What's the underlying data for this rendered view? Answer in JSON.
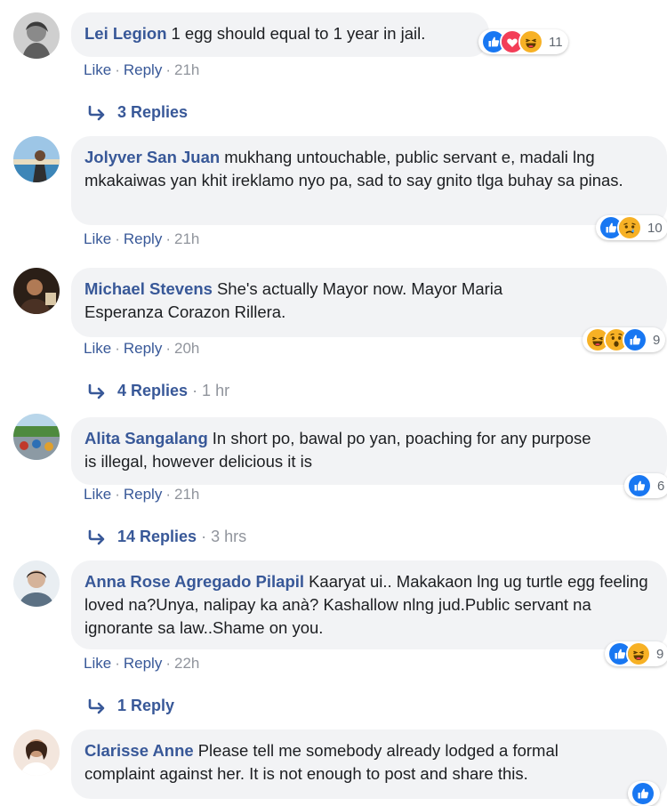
{
  "action_labels": {
    "like": "Like",
    "reply": "Reply",
    "sep": "·"
  },
  "comments": [
    {
      "author": "Lei Legion",
      "text": "1 egg should equal to 1 year in jail.",
      "time": "21h",
      "reactions": [
        "like",
        "love",
        "haha"
      ],
      "reaction_count": "11",
      "replies_label": "3 Replies",
      "replies_time": ""
    },
    {
      "author": "Jolyver San Juan",
      "text": "mukhang untouchable, public servant e, madali lng mkakaiwas yan khit ireklamo nyo pa, sad to say gnito tlga buhay sa pinas.",
      "time": "21h",
      "reactions": [
        "like",
        "sad"
      ],
      "reaction_count": "10"
    },
    {
      "author": "Michael Stevens",
      "text": "She's actually Mayor now. Mayor Maria Esperanza Corazon Rillera.",
      "time": "20h",
      "reactions": [
        "haha",
        "wow",
        "like"
      ],
      "reaction_count": "9",
      "replies_label": "4 Replies",
      "replies_time": "· 1 hr"
    },
    {
      "author": "Alita Sangalang",
      "text": "In short po, bawal po yan, poaching for any purpose is illegal, however delicious it is",
      "time": "21h",
      "reactions": [
        "like"
      ],
      "reaction_count": "6",
      "replies_label": "14 Replies",
      "replies_time": "· 3 hrs"
    },
    {
      "author": "Anna Rose Agregado Pilapil",
      "text": "Kaaryat ui.. Makakaon lng ug turtle egg feeling loved na?Unya, nalipay ka anà? Kashallow nlng jud.Public servant na ignorante sa law..Shame on you.",
      "time": "22h",
      "reactions": [
        "like",
        "haha"
      ],
      "reaction_count": "9",
      "replies_label": "1 Reply",
      "replies_time": ""
    },
    {
      "author": "Clarisse Anne",
      "text": "Please tell me somebody already lodged a formal complaint against her. It is not enough to post and share this.",
      "reactions": [
        "like"
      ],
      "reaction_count": ""
    }
  ],
  "colors": {
    "author": "#385898",
    "bubble": "#f2f3f5",
    "meta": "#90949c",
    "like_blue": "#1877f2",
    "love_red": "#f33e58",
    "emoji_yellow": "#f7b125"
  }
}
